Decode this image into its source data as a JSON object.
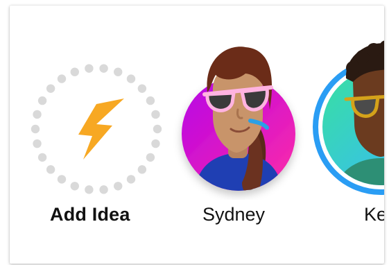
{
  "stories": {
    "add": {
      "label": "Add Idea",
      "icon": "lightning-bolt-icon",
      "dot_color": "#d9d9d9",
      "bolt_color": "#f7a823"
    },
    "sydney": {
      "label": "Sydney",
      "avatar": "avatar-sunglasses-woman",
      "ring_gradient": [
        "#b400e8",
        "#ff2ea6"
      ]
    },
    "kevin": {
      "label": "Kev",
      "avatar": "avatar-sunglasses-man",
      "ring_color": "#2a9df4",
      "ring_gradient": [
        "#38b7ff",
        "#38e0a0"
      ]
    }
  }
}
